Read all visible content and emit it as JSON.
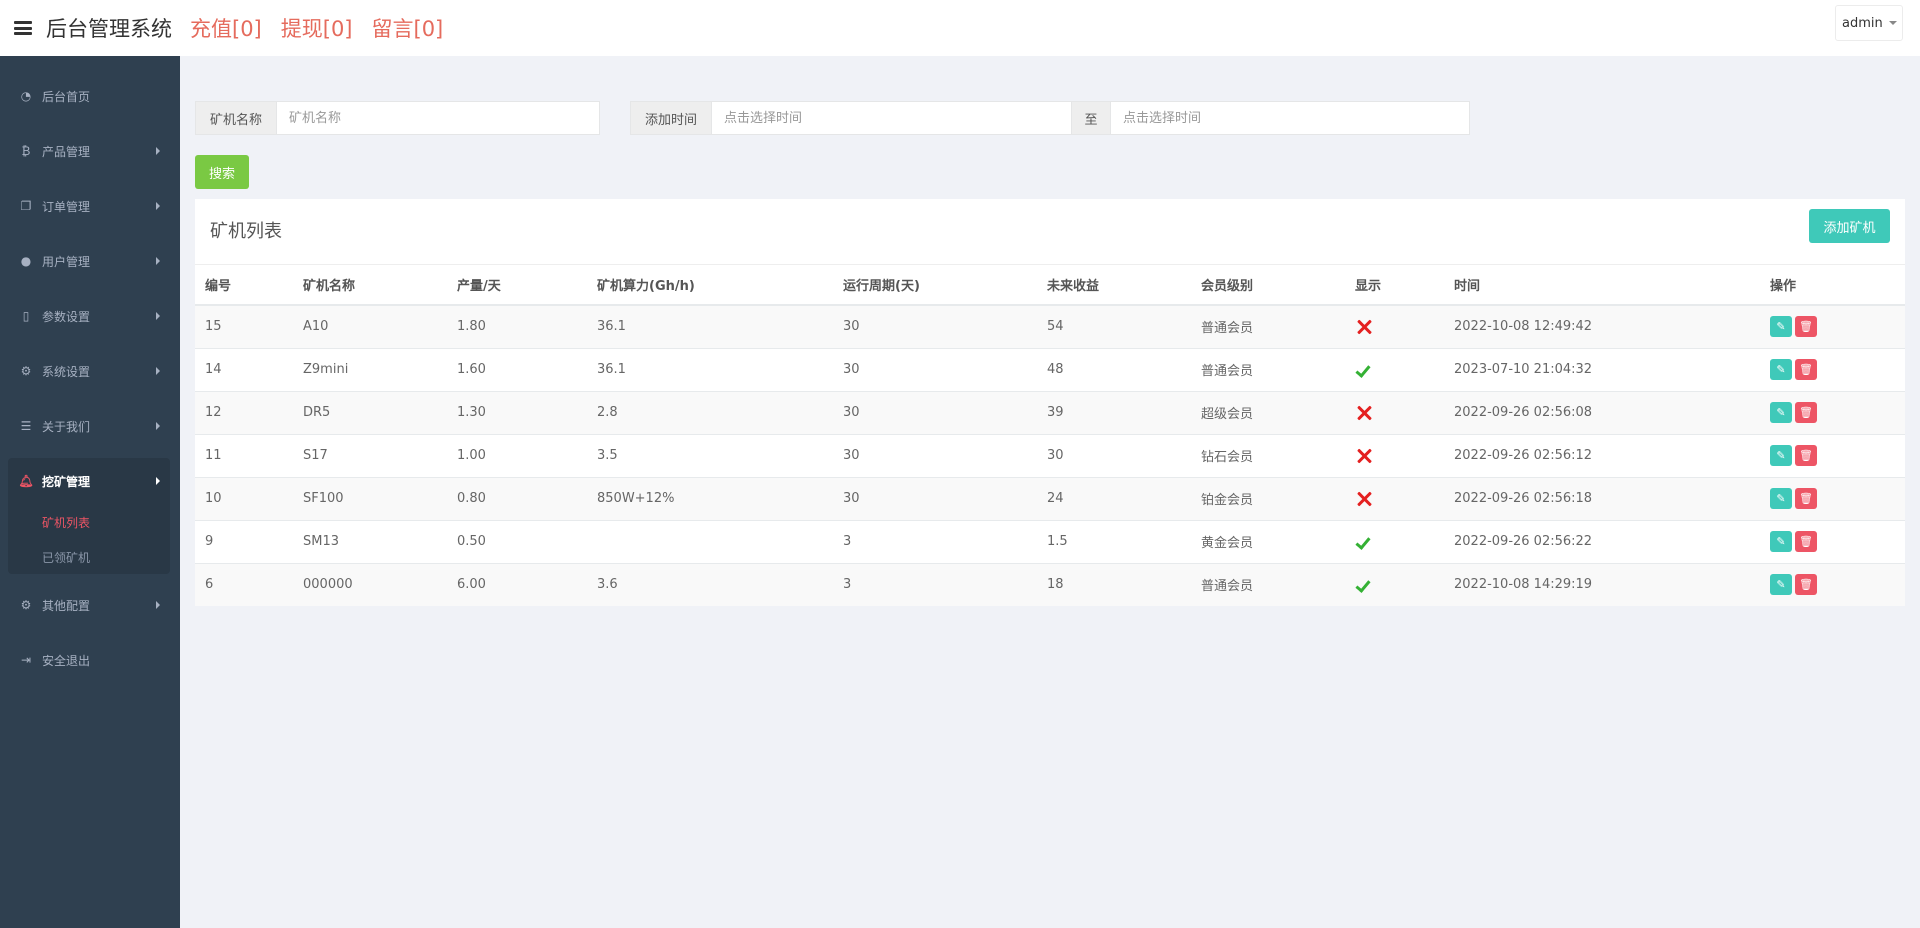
{
  "header": {
    "title": "后台管理系统",
    "links": [
      "充值[0]",
      "提现[0]",
      "留言[0]"
    ],
    "user": "admin"
  },
  "sidebar": {
    "items": [
      {
        "label": "后台首页",
        "icon": "dashboard-icon"
      },
      {
        "label": "产品管理",
        "icon": "bitcoin-icon"
      },
      {
        "label": "订单管理",
        "icon": "copy-icon"
      },
      {
        "label": "用户管理",
        "icon": "user-icon"
      },
      {
        "label": "参数设置",
        "icon": "file-icon"
      },
      {
        "label": "系统设置",
        "icon": "cogs-icon"
      },
      {
        "label": "关于我们",
        "icon": "list-icon"
      },
      {
        "label": "挖矿管理",
        "icon": "bell-icon"
      },
      {
        "label": "其他配置",
        "icon": "gear-icon"
      },
      {
        "label": "安全退出",
        "icon": "sign-out-icon"
      }
    ],
    "subitems": [
      "矿机列表",
      "已领矿机"
    ]
  },
  "search": {
    "name_label": "矿机名称",
    "name_placeholder": "矿机名称",
    "time_label": "添加时间",
    "time_placeholder_start": "点击选择时间",
    "to_label": "至",
    "time_placeholder_end": "点击选择时间",
    "button": "搜索"
  },
  "panel": {
    "title": "矿机列表",
    "add_button": "添加矿机",
    "columns": [
      "编号",
      "矿机名称",
      "产量/天",
      "矿机算力(Gh/h)",
      "运行周期(天)",
      "未来收益",
      "会员级别",
      "显示",
      "时间",
      "操作"
    ],
    "rows": [
      {
        "id": "15",
        "name": "A10",
        "output": "1.80",
        "power": "36.1",
        "cycle": "30",
        "income": "54",
        "level": "普通会员",
        "show": false,
        "time": "2022-10-08 12:49:42"
      },
      {
        "id": "14",
        "name": "Z9mini",
        "output": "1.60",
        "power": "36.1",
        "cycle": "30",
        "income": "48",
        "level": "普通会员",
        "show": true,
        "time": "2023-07-10 21:04:32"
      },
      {
        "id": "12",
        "name": "DR5",
        "output": "1.30",
        "power": "2.8",
        "cycle": "30",
        "income": "39",
        "level": "超级会员",
        "show": false,
        "time": "2022-09-26 02:56:08"
      },
      {
        "id": "11",
        "name": "S17",
        "output": "1.00",
        "power": "3.5",
        "cycle": "30",
        "income": "30",
        "level": "钻石会员",
        "show": false,
        "time": "2022-09-26 02:56:12"
      },
      {
        "id": "10",
        "name": "SF100",
        "output": "0.80",
        "power": "850W+12%",
        "cycle": "30",
        "income": "24",
        "level": "铂金会员",
        "show": false,
        "time": "2022-09-26 02:56:18"
      },
      {
        "id": "9",
        "name": "SM13",
        "output": "0.50",
        "power": "",
        "cycle": "3",
        "income": "1.5",
        "level": "黄金会员",
        "show": true,
        "time": "2022-09-26 02:56:22"
      },
      {
        "id": "6",
        "name": "000000",
        "output": "6.00",
        "power": "3.6",
        "cycle": "3",
        "income": "18",
        "level": "普通会员",
        "show": true,
        "time": "2022-10-08 14:29:19"
      }
    ]
  },
  "colors": {
    "sidebar": "#2f4050",
    "accent_red": "#e56b5d",
    "search_green": "#7ac943",
    "teal": "#3fc9b9",
    "delete_red": "#ed5565"
  }
}
